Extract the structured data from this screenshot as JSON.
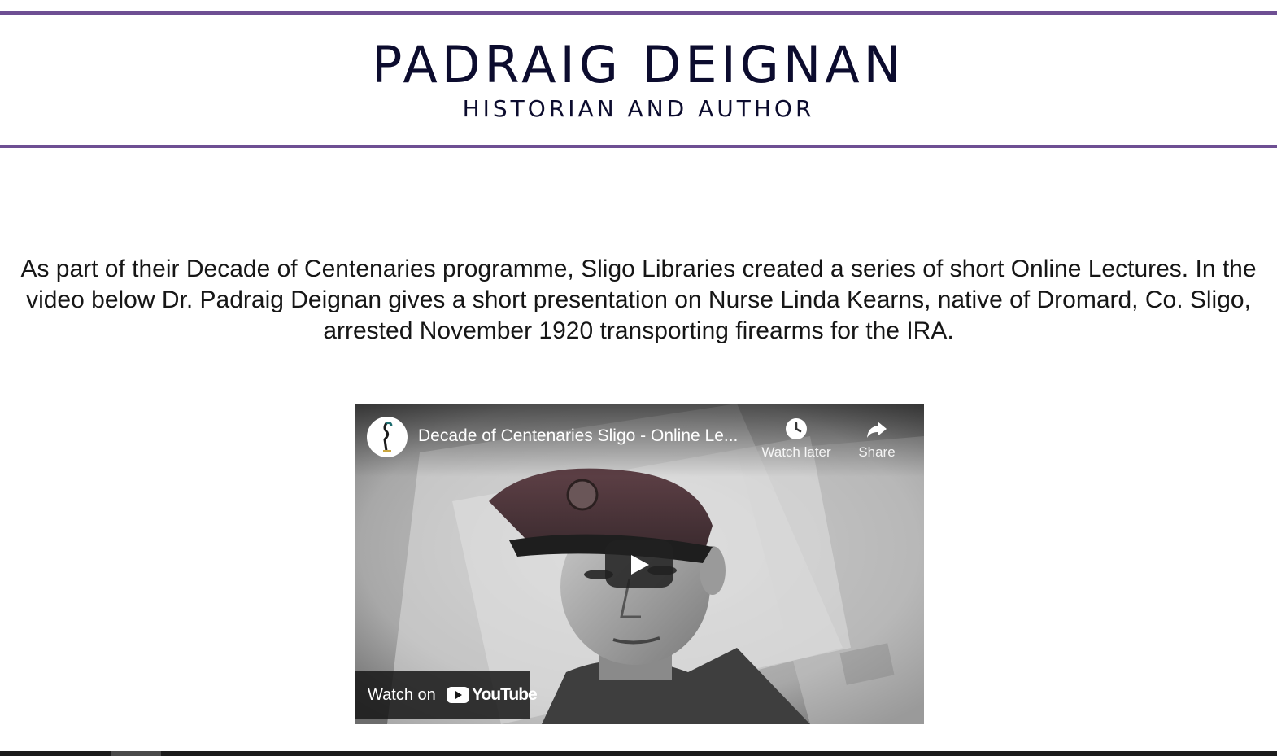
{
  "header": {
    "title": "PADRAIG DEIGNAN",
    "tagline": "HISTORIAN AND AUTHOR",
    "accent_color": "#6e4f93"
  },
  "intro": {
    "text": "As part of their Decade of Centenaries programme, Sligo Libraries created a series of short Online Lectures. In the video below Dr. Padraig Deignan gives a short presentation on Nurse Linda Kearns, native of Dromard, Co. Sligo, arrested November 1920 transporting firearms for the IRA."
  },
  "video": {
    "title": "Decade of Centenaries Sligo - Online Le...",
    "watch_later_label": "Watch later",
    "share_label": "Share",
    "watch_on_label": "Watch on",
    "youtube_wordmark": "YouTube",
    "icons": {
      "channel": "heron-logo-icon",
      "watch_later": "clock-icon",
      "share": "share-arrow-icon",
      "play": "play-icon",
      "youtube": "youtube-logo-icon"
    },
    "colors": {
      "youtube_red": "#ffffff",
      "overlay": "#212121"
    }
  }
}
